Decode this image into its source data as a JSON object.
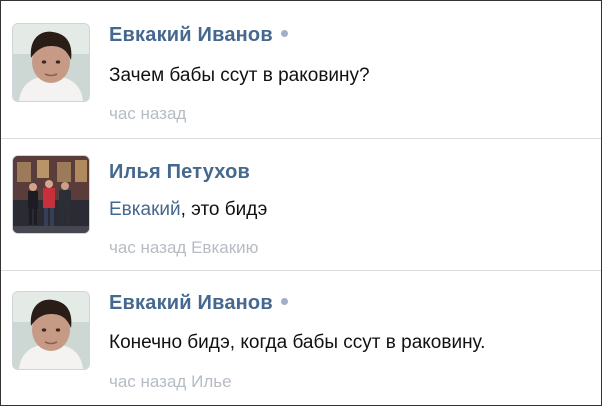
{
  "comments": [
    {
      "author": "Евкакий Иванов",
      "online": true,
      "text": "Зачем бабы ссут в раковину?",
      "time": "час назад",
      "reply_to": ""
    },
    {
      "author": "Илья Петухов",
      "online": false,
      "mention": "Евкакий",
      "text": ", это бидэ",
      "time": "час назад",
      "reply_to": "Евкакию"
    },
    {
      "author": "Евкакий Иванов",
      "online": true,
      "text": "Конечно бидэ, когда бабы ссут в раковину.",
      "time": "час назад",
      "reply_to": "Илье"
    }
  ],
  "colors": {
    "author": "#45688e",
    "meta": "#b5bcc4",
    "online_dot": "#9fb1c5",
    "divider": "#d9dde2"
  }
}
